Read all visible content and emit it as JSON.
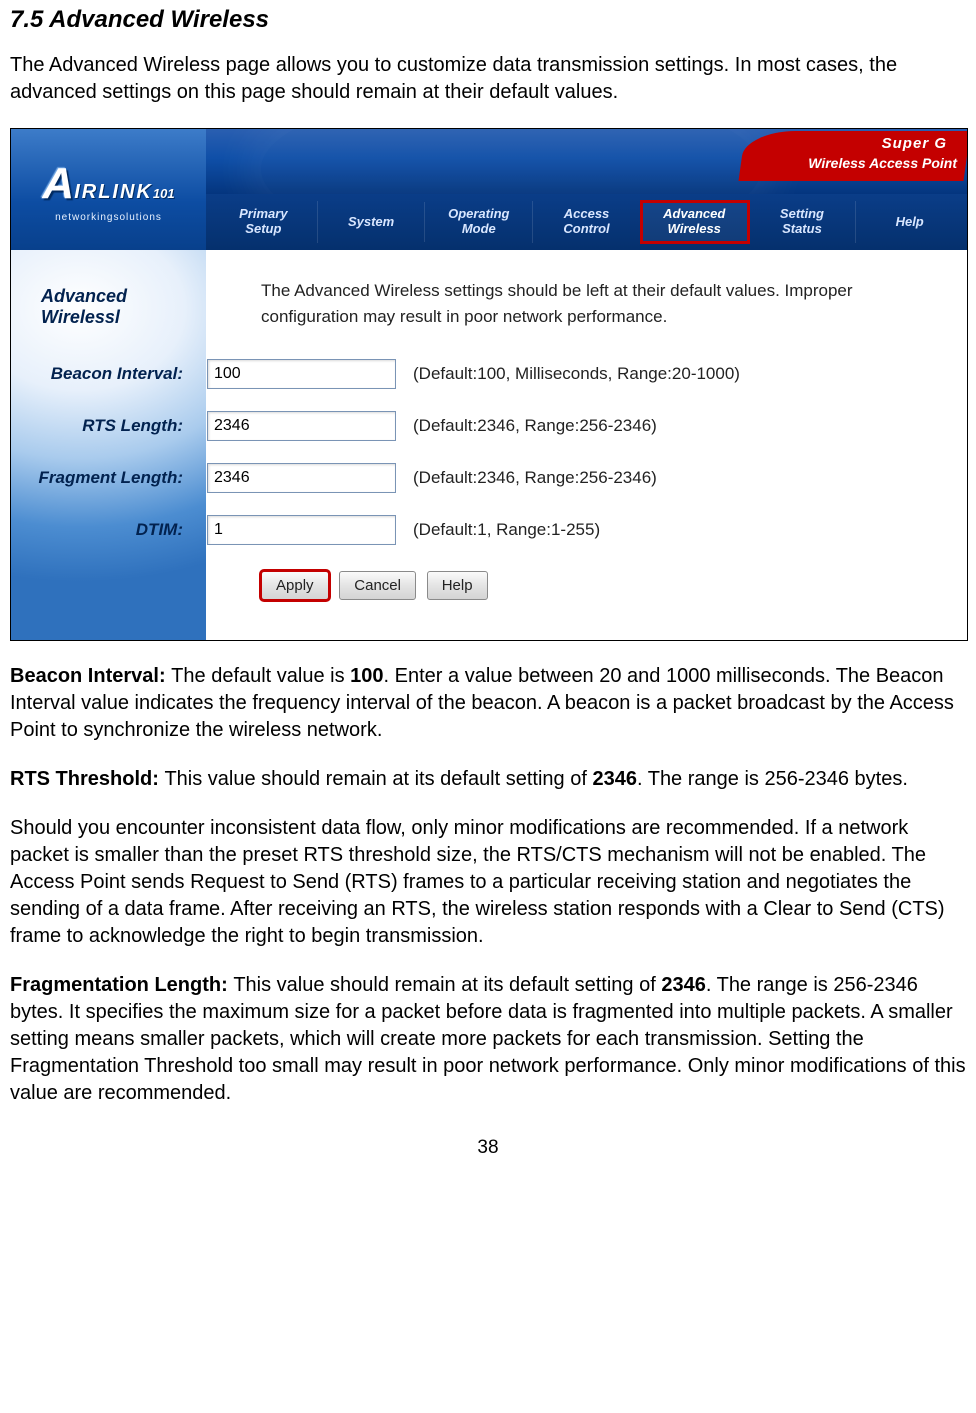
{
  "heading": "7.5 Advanced Wireless",
  "intro": "The Advanced Wireless page allows you to customize data transmission settings. In most cases, the advanced settings on this page should remain at their default values.",
  "banner": {
    "superg_line1": "Super G",
    "superg_line2": "Wireless Access Point"
  },
  "logo": {
    "a": "A",
    "rest": "IRLINK",
    "model": "101",
    "sub": "networkingsolutions"
  },
  "nav": [
    {
      "line1": "Primary",
      "line2": "Setup"
    },
    {
      "line1": "System",
      "line2": ""
    },
    {
      "line1": "Operating",
      "line2": "Mode"
    },
    {
      "line1": "Access",
      "line2": "Control"
    },
    {
      "line1": "Advanced",
      "line2": "Wireless"
    },
    {
      "line1": "Setting",
      "line2": "Status"
    },
    {
      "line1": "Help",
      "line2": ""
    }
  ],
  "active_nav_index": 4,
  "sidebar_title": "Advanced Wirelessl",
  "info": "The Advanced Wireless settings should be left at their default values. Improper configuration may result in poor network performance.",
  "fields": [
    {
      "label": "Beacon Interval:",
      "value": "100",
      "hint": "(Default:100, Milliseconds, Range:20-1000)"
    },
    {
      "label": "RTS Length:",
      "value": "2346",
      "hint": "(Default:2346, Range:256-2346)"
    },
    {
      "label": "Fragment Length:",
      "value": "2346",
      "hint": "(Default:2346, Range:256-2346)"
    },
    {
      "label": "DTIM:",
      "value": "1",
      "hint": "(Default:1, Range:1-255)"
    }
  ],
  "buttons": {
    "apply": "Apply",
    "cancel": "Cancel",
    "help": "Help"
  },
  "desc": {
    "p1a": "Beacon Interval: ",
    "p1b": "The default value is ",
    "p1c": "100",
    "p1d": ". Enter a value between 20 and 1000 milliseconds. The Beacon Interval value indicates the frequency interval of the beacon. A beacon is a packet broadcast by the Access Point to synchronize the wireless network.",
    "p2a": "RTS Threshold: ",
    "p2b": "This value should remain at its default setting of ",
    "p2c": "2346",
    "p2d": ". The range is 256-2346 bytes.",
    "p3": "Should you encounter inconsistent data flow, only minor modifications are recommended. If a network packet is smaller than the preset RTS threshold size, the RTS/CTS mechanism will not be enabled. The Access Point sends Request to Send (RTS) frames to a particular receiving station and negotiates the sending of a data frame. After receiving an RTS, the wireless station responds with a Clear to Send (CTS) frame to acknowledge the right to begin transmission.",
    "p4a": "Fragmentation Length: ",
    "p4b": "This value should remain at its default setting of ",
    "p4c": "2346",
    "p4d": ". The range is 256-2346 bytes. It specifies the maximum size for a packet before data is fragmented into multiple packets. A smaller setting means smaller packets, which will create more packets for each transmission. Setting the Fragmentation Threshold too small may result in poor network performance. Only minor modifications of this value are recommended."
  },
  "page_number": "38"
}
